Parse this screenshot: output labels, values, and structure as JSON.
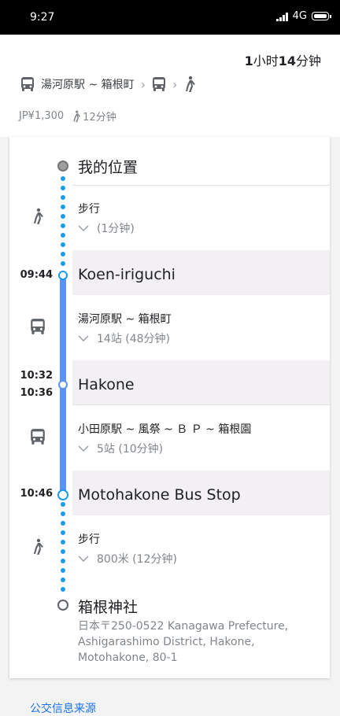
{
  "status_bar": {
    "time": "9:27",
    "network": "4G"
  },
  "summary": {
    "duration_hours": "1",
    "duration_hours_unit": "小时",
    "duration_minutes": "14",
    "duration_minutes_unit": "分钟",
    "route_first_line": "湯河原駅 ~ 箱根町",
    "fare": "JP¥1,300",
    "walk_total": "12分钟"
  },
  "stops": [
    {
      "name": "我的位置"
    },
    {
      "name": "Koen-iriguchi",
      "time": "09:44"
    },
    {
      "name": "Hakone",
      "time_arrive": "10:32",
      "time_depart": "10:36"
    },
    {
      "name": "Motohakone Bus Stop",
      "time": "10:46"
    },
    {
      "name": "箱根神社",
      "address": "日本〒250-0522 Kanagawa Prefecture, Ashigarashimo District, Hakone, Motohakone, 80-1"
    }
  ],
  "segments": [
    {
      "mode": "walk",
      "title": "步行",
      "detail": "(1分钟)"
    },
    {
      "mode": "bus",
      "title": "湯河原駅 ~ 箱根町",
      "detail": "14站 (48分钟)"
    },
    {
      "mode": "bus",
      "title": "小田原駅 ~ 風祭 ~ Ｂ Ｐ ~ 箱根園",
      "detail": "5站 (10分钟)"
    },
    {
      "mode": "walk",
      "title": "步行",
      "detail": "800米 (12分钟)"
    }
  ],
  "footer": {
    "link": "公交信息来源"
  },
  "colors": {
    "accent_line": "#5a94f0",
    "dotted_line": "#1a9ce8",
    "node_outline": "#1a9ce8",
    "stop_band": "#f3f0f4"
  }
}
